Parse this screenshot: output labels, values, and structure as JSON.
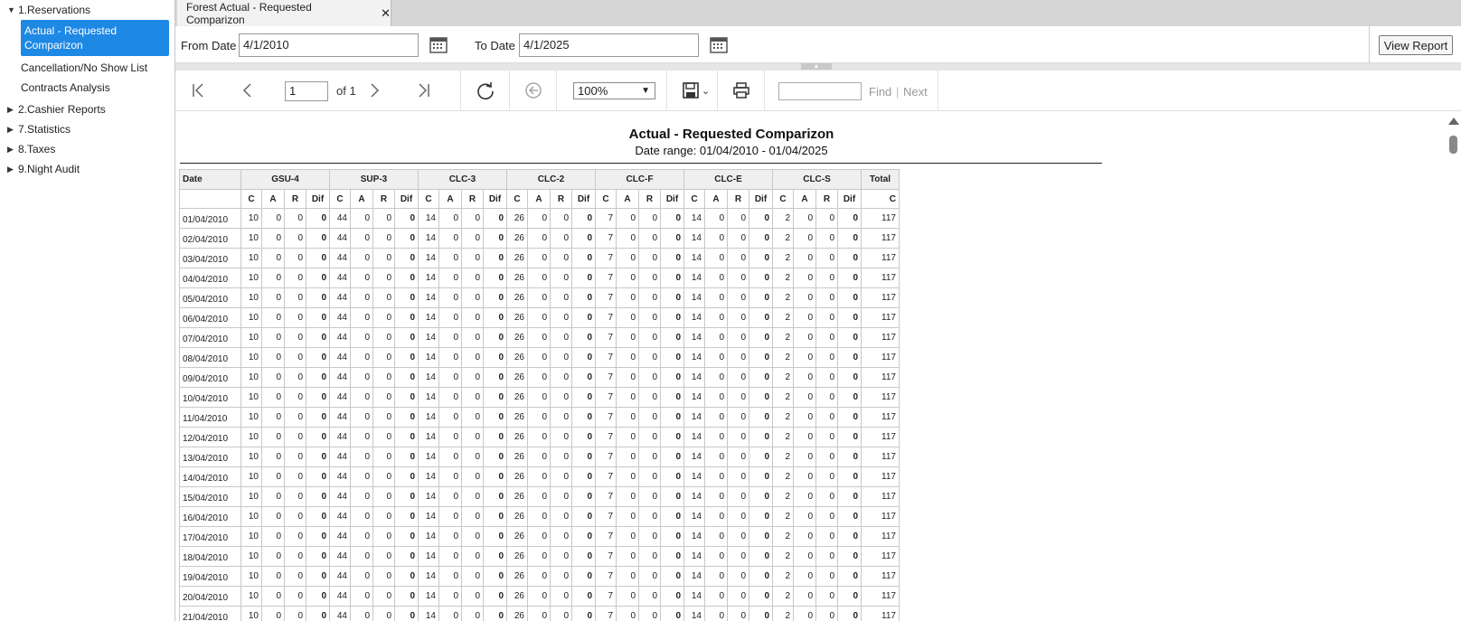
{
  "sidebar": {
    "nodes": [
      {
        "label": "1.Reservations",
        "expanded": true
      },
      {
        "label": "2.Cashier Reports",
        "expanded": false
      },
      {
        "label": "7.Statistics",
        "expanded": false
      },
      {
        "label": "8.Taxes",
        "expanded": false
      },
      {
        "label": "9.Night Audit",
        "expanded": false
      }
    ],
    "children": {
      "selected_line1": "Actual - Requested",
      "selected_line2": "Comparizon",
      "item2": "Cancellation/No Show List",
      "item3": "Contracts Analysis"
    },
    "selected_color": "#1e88e5"
  },
  "tab": {
    "title": "Forest Actual - Requested Comparizon",
    "close": "✕"
  },
  "params": {
    "from_label": "From Date",
    "from_value": "4/1/2010",
    "to_label": "To Date",
    "to_value": "4/1/2025",
    "view_report": "View Report"
  },
  "toolbar": {
    "page_value": "1",
    "of_label": "of 1",
    "zoom": "100%",
    "find_label": "Find",
    "sep": "|",
    "next_label": "Next"
  },
  "report": {
    "title": "Actual - Requested Comparizon",
    "subtitle": "Date range: 01/04/2010 - 01/04/2025",
    "date_header": "Date",
    "groups": [
      "GSU-4",
      "SUP-3",
      "CLC-3",
      "CLC-2",
      "CLC-F",
      "CLC-E",
      "CLC-S"
    ],
    "total_header": "Total",
    "sub_headers": [
      "C",
      "A",
      "R",
      "Dif"
    ],
    "total_sub": "C",
    "rows": [
      {
        "date": "01/04/2010",
        "vals": [
          [
            "10",
            "0",
            "0",
            "0"
          ],
          [
            "44",
            "0",
            "0",
            "0"
          ],
          [
            "14",
            "0",
            "0",
            "0"
          ],
          [
            "26",
            "0",
            "0",
            "0"
          ],
          [
            "7",
            "0",
            "0",
            "0"
          ],
          [
            "14",
            "0",
            "0",
            "0"
          ],
          [
            "2",
            "0",
            "0",
            "0"
          ]
        ],
        "total": "117"
      },
      {
        "date": "02/04/2010",
        "vals": [
          [
            "10",
            "0",
            "0",
            "0"
          ],
          [
            "44",
            "0",
            "0",
            "0"
          ],
          [
            "14",
            "0",
            "0",
            "0"
          ],
          [
            "26",
            "0",
            "0",
            "0"
          ],
          [
            "7",
            "0",
            "0",
            "0"
          ],
          [
            "14",
            "0",
            "0",
            "0"
          ],
          [
            "2",
            "0",
            "0",
            "0"
          ]
        ],
        "total": "117"
      },
      {
        "date": "03/04/2010",
        "vals": [
          [
            "10",
            "0",
            "0",
            "0"
          ],
          [
            "44",
            "0",
            "0",
            "0"
          ],
          [
            "14",
            "0",
            "0",
            "0"
          ],
          [
            "26",
            "0",
            "0",
            "0"
          ],
          [
            "7",
            "0",
            "0",
            "0"
          ],
          [
            "14",
            "0",
            "0",
            "0"
          ],
          [
            "2",
            "0",
            "0",
            "0"
          ]
        ],
        "total": "117"
      },
      {
        "date": "04/04/2010",
        "vals": [
          [
            "10",
            "0",
            "0",
            "0"
          ],
          [
            "44",
            "0",
            "0",
            "0"
          ],
          [
            "14",
            "0",
            "0",
            "0"
          ],
          [
            "26",
            "0",
            "0",
            "0"
          ],
          [
            "7",
            "0",
            "0",
            "0"
          ],
          [
            "14",
            "0",
            "0",
            "0"
          ],
          [
            "2",
            "0",
            "0",
            "0"
          ]
        ],
        "total": "117"
      },
      {
        "date": "05/04/2010",
        "vals": [
          [
            "10",
            "0",
            "0",
            "0"
          ],
          [
            "44",
            "0",
            "0",
            "0"
          ],
          [
            "14",
            "0",
            "0",
            "0"
          ],
          [
            "26",
            "0",
            "0",
            "0"
          ],
          [
            "7",
            "0",
            "0",
            "0"
          ],
          [
            "14",
            "0",
            "0",
            "0"
          ],
          [
            "2",
            "0",
            "0",
            "0"
          ]
        ],
        "total": "117"
      },
      {
        "date": "06/04/2010",
        "vals": [
          [
            "10",
            "0",
            "0",
            "0"
          ],
          [
            "44",
            "0",
            "0",
            "0"
          ],
          [
            "14",
            "0",
            "0",
            "0"
          ],
          [
            "26",
            "0",
            "0",
            "0"
          ],
          [
            "7",
            "0",
            "0",
            "0"
          ],
          [
            "14",
            "0",
            "0",
            "0"
          ],
          [
            "2",
            "0",
            "0",
            "0"
          ]
        ],
        "total": "117"
      },
      {
        "date": "07/04/2010",
        "vals": [
          [
            "10",
            "0",
            "0",
            "0"
          ],
          [
            "44",
            "0",
            "0",
            "0"
          ],
          [
            "14",
            "0",
            "0",
            "0"
          ],
          [
            "26",
            "0",
            "0",
            "0"
          ],
          [
            "7",
            "0",
            "0",
            "0"
          ],
          [
            "14",
            "0",
            "0",
            "0"
          ],
          [
            "2",
            "0",
            "0",
            "0"
          ]
        ],
        "total": "117"
      },
      {
        "date": "08/04/2010",
        "vals": [
          [
            "10",
            "0",
            "0",
            "0"
          ],
          [
            "44",
            "0",
            "0",
            "0"
          ],
          [
            "14",
            "0",
            "0",
            "0"
          ],
          [
            "26",
            "0",
            "0",
            "0"
          ],
          [
            "7",
            "0",
            "0",
            "0"
          ],
          [
            "14",
            "0",
            "0",
            "0"
          ],
          [
            "2",
            "0",
            "0",
            "0"
          ]
        ],
        "total": "117"
      },
      {
        "date": "09/04/2010",
        "vals": [
          [
            "10",
            "0",
            "0",
            "0"
          ],
          [
            "44",
            "0",
            "0",
            "0"
          ],
          [
            "14",
            "0",
            "0",
            "0"
          ],
          [
            "26",
            "0",
            "0",
            "0"
          ],
          [
            "7",
            "0",
            "0",
            "0"
          ],
          [
            "14",
            "0",
            "0",
            "0"
          ],
          [
            "2",
            "0",
            "0",
            "0"
          ]
        ],
        "total": "117"
      },
      {
        "date": "10/04/2010",
        "vals": [
          [
            "10",
            "0",
            "0",
            "0"
          ],
          [
            "44",
            "0",
            "0",
            "0"
          ],
          [
            "14",
            "0",
            "0",
            "0"
          ],
          [
            "26",
            "0",
            "0",
            "0"
          ],
          [
            "7",
            "0",
            "0",
            "0"
          ],
          [
            "14",
            "0",
            "0",
            "0"
          ],
          [
            "2",
            "0",
            "0",
            "0"
          ]
        ],
        "total": "117"
      },
      {
        "date": "11/04/2010",
        "vals": [
          [
            "10",
            "0",
            "0",
            "0"
          ],
          [
            "44",
            "0",
            "0",
            "0"
          ],
          [
            "14",
            "0",
            "0",
            "0"
          ],
          [
            "26",
            "0",
            "0",
            "0"
          ],
          [
            "7",
            "0",
            "0",
            "0"
          ],
          [
            "14",
            "0",
            "0",
            "0"
          ],
          [
            "2",
            "0",
            "0",
            "0"
          ]
        ],
        "total": "117"
      },
      {
        "date": "12/04/2010",
        "vals": [
          [
            "10",
            "0",
            "0",
            "0"
          ],
          [
            "44",
            "0",
            "0",
            "0"
          ],
          [
            "14",
            "0",
            "0",
            "0"
          ],
          [
            "26",
            "0",
            "0",
            "0"
          ],
          [
            "7",
            "0",
            "0",
            "0"
          ],
          [
            "14",
            "0",
            "0",
            "0"
          ],
          [
            "2",
            "0",
            "0",
            "0"
          ]
        ],
        "total": "117"
      },
      {
        "date": "13/04/2010",
        "vals": [
          [
            "10",
            "0",
            "0",
            "0"
          ],
          [
            "44",
            "0",
            "0",
            "0"
          ],
          [
            "14",
            "0",
            "0",
            "0"
          ],
          [
            "26",
            "0",
            "0",
            "0"
          ],
          [
            "7",
            "0",
            "0",
            "0"
          ],
          [
            "14",
            "0",
            "0",
            "0"
          ],
          [
            "2",
            "0",
            "0",
            "0"
          ]
        ],
        "total": "117"
      },
      {
        "date": "14/04/2010",
        "vals": [
          [
            "10",
            "0",
            "0",
            "0"
          ],
          [
            "44",
            "0",
            "0",
            "0"
          ],
          [
            "14",
            "0",
            "0",
            "0"
          ],
          [
            "26",
            "0",
            "0",
            "0"
          ],
          [
            "7",
            "0",
            "0",
            "0"
          ],
          [
            "14",
            "0",
            "0",
            "0"
          ],
          [
            "2",
            "0",
            "0",
            "0"
          ]
        ],
        "total": "117"
      },
      {
        "date": "15/04/2010",
        "vals": [
          [
            "10",
            "0",
            "0",
            "0"
          ],
          [
            "44",
            "0",
            "0",
            "0"
          ],
          [
            "14",
            "0",
            "0",
            "0"
          ],
          [
            "26",
            "0",
            "0",
            "0"
          ],
          [
            "7",
            "0",
            "0",
            "0"
          ],
          [
            "14",
            "0",
            "0",
            "0"
          ],
          [
            "2",
            "0",
            "0",
            "0"
          ]
        ],
        "total": "117"
      },
      {
        "date": "16/04/2010",
        "vals": [
          [
            "10",
            "0",
            "0",
            "0"
          ],
          [
            "44",
            "0",
            "0",
            "0"
          ],
          [
            "14",
            "0",
            "0",
            "0"
          ],
          [
            "26",
            "0",
            "0",
            "0"
          ],
          [
            "7",
            "0",
            "0",
            "0"
          ],
          [
            "14",
            "0",
            "0",
            "0"
          ],
          [
            "2",
            "0",
            "0",
            "0"
          ]
        ],
        "total": "117"
      },
      {
        "date": "17/04/2010",
        "vals": [
          [
            "10",
            "0",
            "0",
            "0"
          ],
          [
            "44",
            "0",
            "0",
            "0"
          ],
          [
            "14",
            "0",
            "0",
            "0"
          ],
          [
            "26",
            "0",
            "0",
            "0"
          ],
          [
            "7",
            "0",
            "0",
            "0"
          ],
          [
            "14",
            "0",
            "0",
            "0"
          ],
          [
            "2",
            "0",
            "0",
            "0"
          ]
        ],
        "total": "117"
      },
      {
        "date": "18/04/2010",
        "vals": [
          [
            "10",
            "0",
            "0",
            "0"
          ],
          [
            "44",
            "0",
            "0",
            "0"
          ],
          [
            "14",
            "0",
            "0",
            "0"
          ],
          [
            "26",
            "0",
            "0",
            "0"
          ],
          [
            "7",
            "0",
            "0",
            "0"
          ],
          [
            "14",
            "0",
            "0",
            "0"
          ],
          [
            "2",
            "0",
            "0",
            "0"
          ]
        ],
        "total": "117"
      },
      {
        "date": "19/04/2010",
        "vals": [
          [
            "10",
            "0",
            "0",
            "0"
          ],
          [
            "44",
            "0",
            "0",
            "0"
          ],
          [
            "14",
            "0",
            "0",
            "0"
          ],
          [
            "26",
            "0",
            "0",
            "0"
          ],
          [
            "7",
            "0",
            "0",
            "0"
          ],
          [
            "14",
            "0",
            "0",
            "0"
          ],
          [
            "2",
            "0",
            "0",
            "0"
          ]
        ],
        "total": "117"
      },
      {
        "date": "20/04/2010",
        "vals": [
          [
            "10",
            "0",
            "0",
            "0"
          ],
          [
            "44",
            "0",
            "0",
            "0"
          ],
          [
            "14",
            "0",
            "0",
            "0"
          ],
          [
            "26",
            "0",
            "0",
            "0"
          ],
          [
            "7",
            "0",
            "0",
            "0"
          ],
          [
            "14",
            "0",
            "0",
            "0"
          ],
          [
            "2",
            "0",
            "0",
            "0"
          ]
        ],
        "total": "117"
      },
      {
        "date": "21/04/2010",
        "vals": [
          [
            "10",
            "0",
            "0",
            "0"
          ],
          [
            "44",
            "0",
            "0",
            "0"
          ],
          [
            "14",
            "0",
            "0",
            "0"
          ],
          [
            "26",
            "0",
            "0",
            "0"
          ],
          [
            "7",
            "0",
            "0",
            "0"
          ],
          [
            "14",
            "0",
            "0",
            "0"
          ],
          [
            "2",
            "0",
            "0",
            "0"
          ]
        ],
        "total": "117"
      }
    ]
  }
}
